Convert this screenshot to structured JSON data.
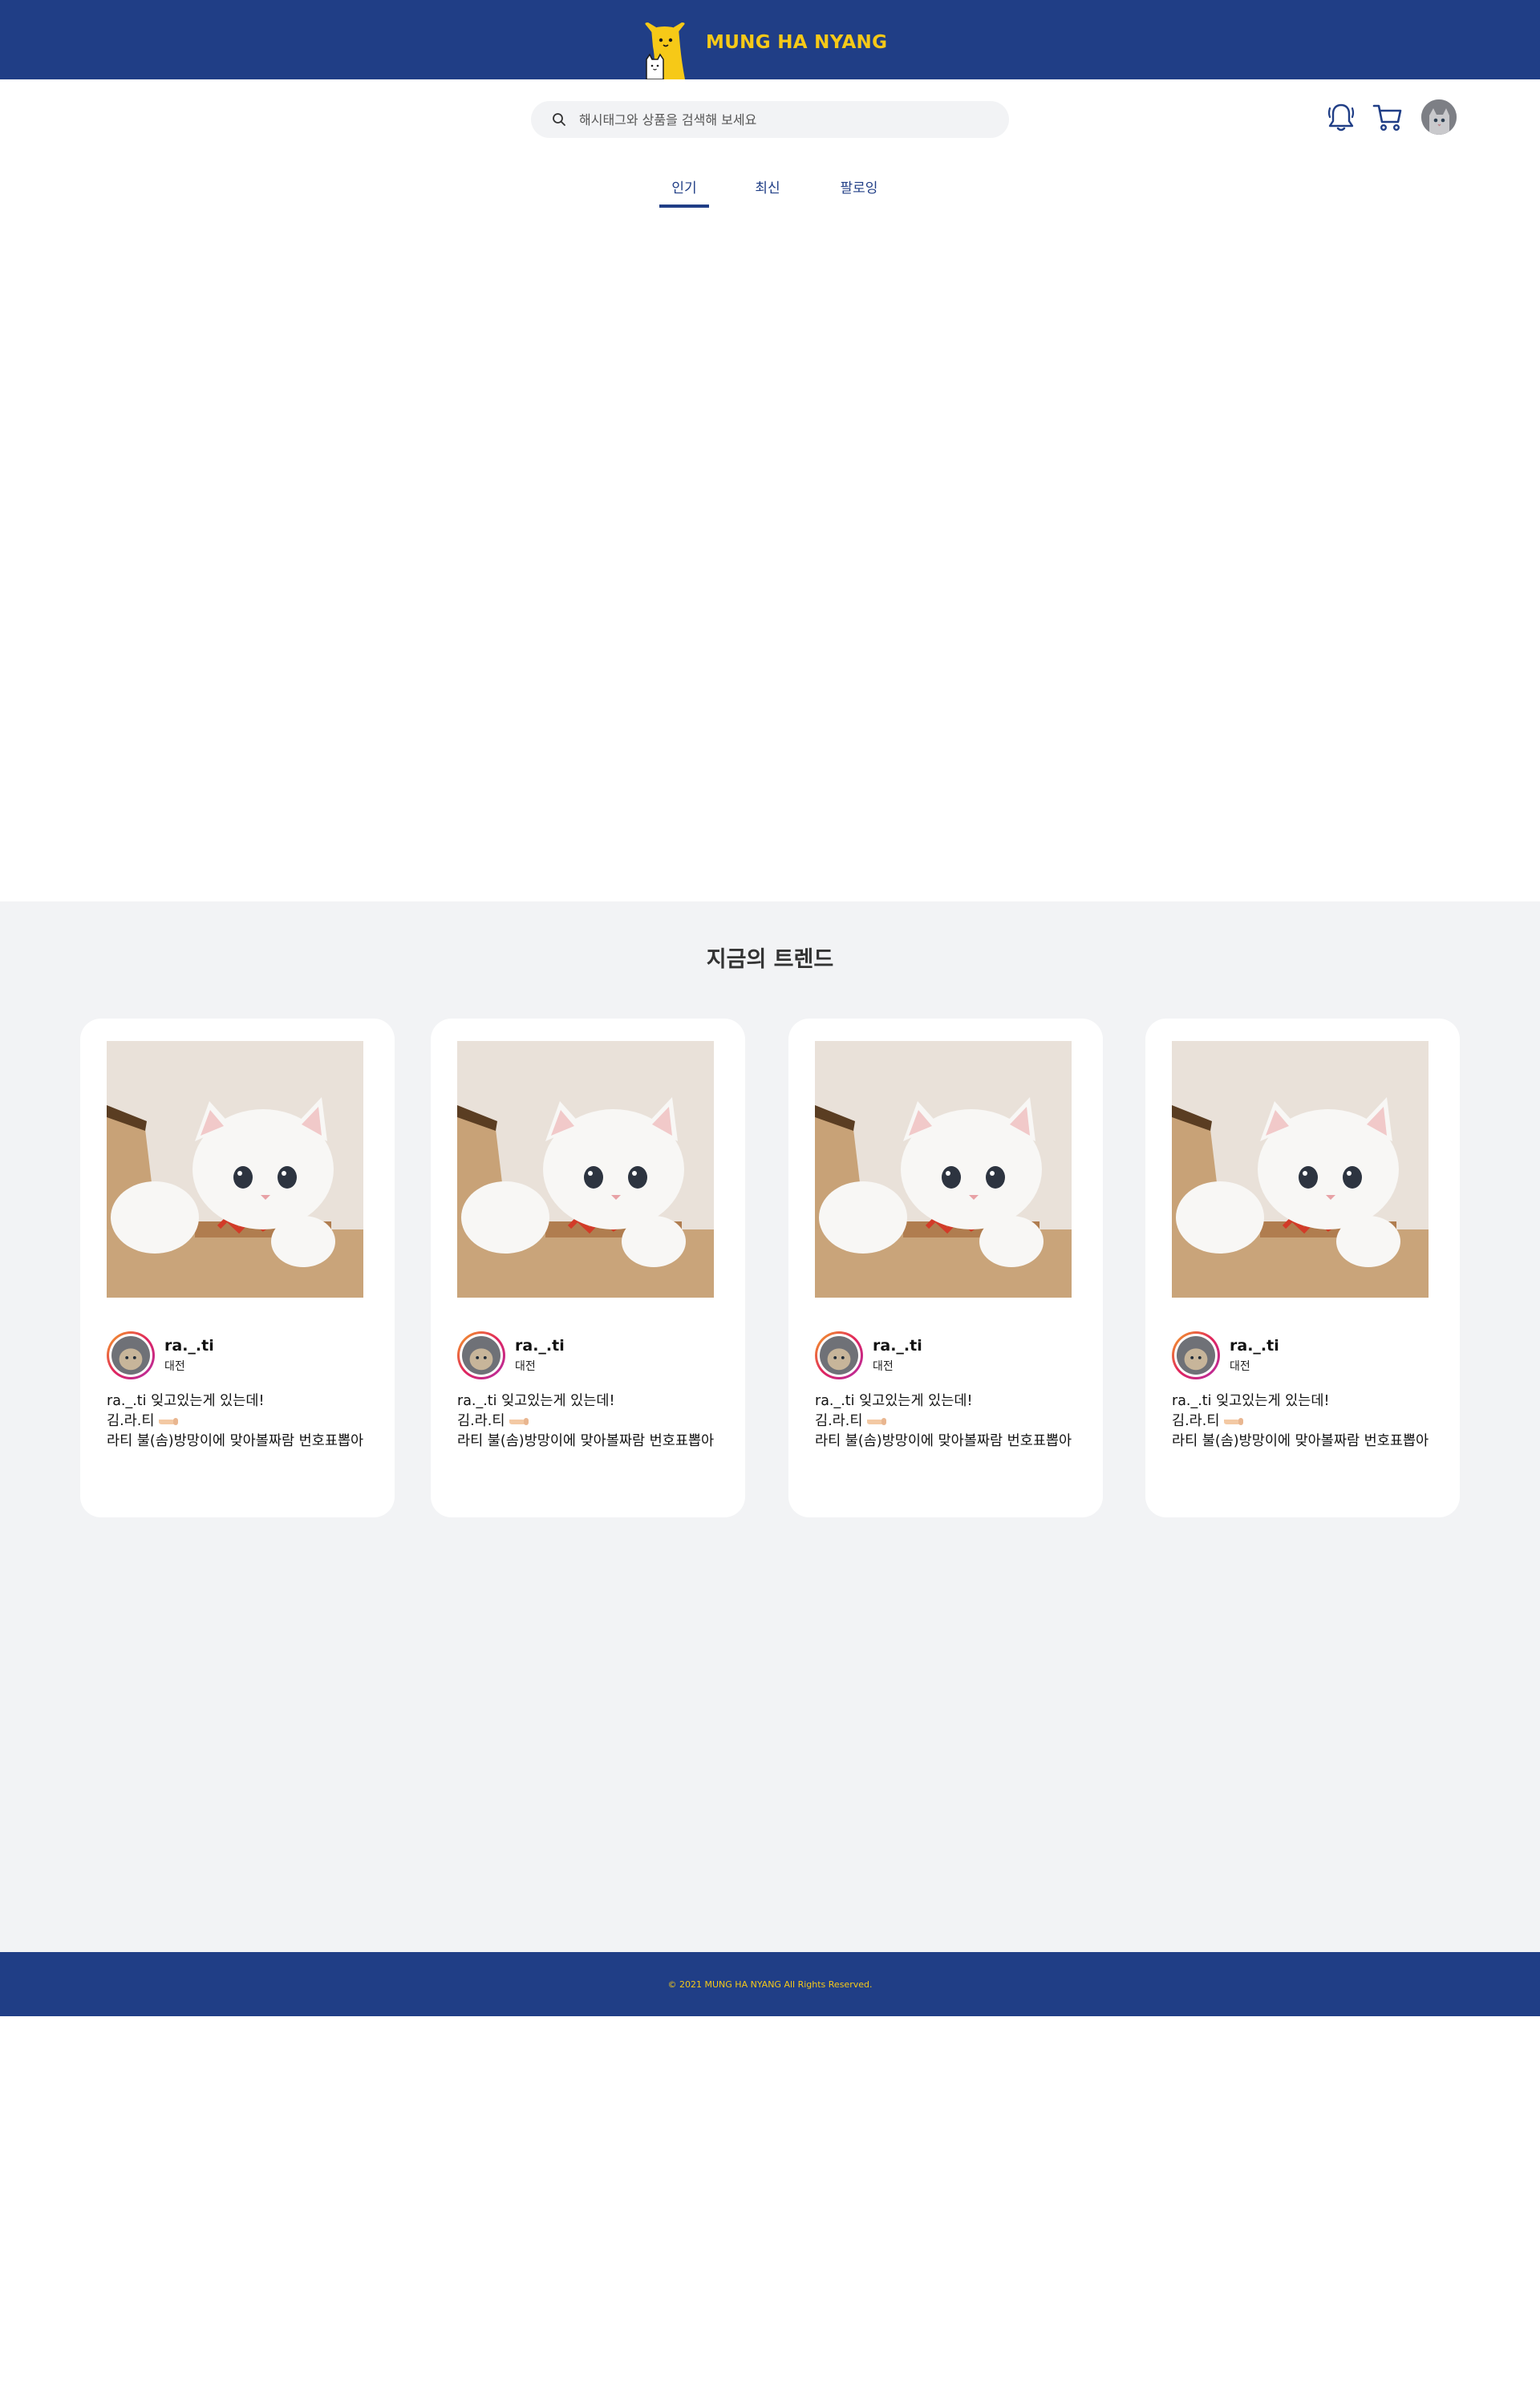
{
  "header": {
    "brand_name": "MUNG HA NYANG",
    "logo_icon": "dog-cat-logo-icon",
    "colors": {
      "header_bg": "#203e86",
      "brand": "#f6c917"
    }
  },
  "search": {
    "placeholder": "해시태그와 상품을 검색해 보세요",
    "value": ""
  },
  "actions": {
    "notification_icon": "bell-icon",
    "cart_icon": "cart-icon",
    "avatar": "profile-avatar"
  },
  "tabs": [
    {
      "label": "인기",
      "active": true
    },
    {
      "label": "최신",
      "active": false
    },
    {
      "label": "팔로잉",
      "active": false
    }
  ],
  "trend": {
    "title": "지금의 트렌드",
    "cards": [
      {
        "username": "ra._.ti",
        "location": "대전",
        "caption_line1": "ra._.ti 잊고있는게 있는데!",
        "caption_line2": "김.라.티",
        "caption_line3": "라티 불(솜)방망이에 맞아볼짜람 번호표뽑아"
      },
      {
        "username": "ra._.ti",
        "location": "대전",
        "caption_line1": "ra._.ti 잊고있는게 있는데!",
        "caption_line2": "김.라.티",
        "caption_line3": "라티 불(솜)방망이에 맞아볼짜람 번호표뽑아"
      },
      {
        "username": "ra._.ti",
        "location": "대전",
        "caption_line1": "ra._.ti 잊고있는게 있는데!",
        "caption_line2": "김.라.티",
        "caption_line3": "라티 불(솜)방망이에 맞아볼짜람 번호표뽑아"
      },
      {
        "username": "ra._.ti",
        "location": "대전",
        "caption_line1": "ra._.ti 잊고있는게 있는데!",
        "caption_line2": "김.라.티",
        "caption_line3": "라티 불(솜)방망이에 맞아볼짜람 번호표뽑아"
      }
    ]
  },
  "footer": {
    "copyright": "© 2021 MUNG HA NYANG All Rights Reserved."
  }
}
